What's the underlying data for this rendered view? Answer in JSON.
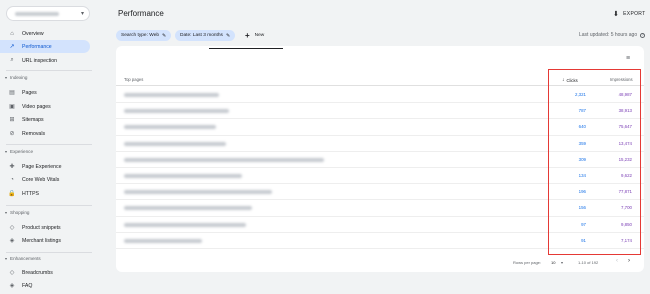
{
  "sidebar": {
    "property_caret": "▾",
    "items": [
      {
        "label": "Overview",
        "icon": "home-icon",
        "glyph": "⌂"
      },
      {
        "label": "Performance",
        "icon": "trend-icon",
        "glyph": "↗"
      },
      {
        "label": "URL inspection",
        "icon": "search-icon",
        "glyph": "⌕"
      }
    ],
    "sections": [
      {
        "title": "Indexing",
        "items": [
          {
            "label": "Pages",
            "glyph": "▤"
          },
          {
            "label": "Video pages",
            "glyph": "▣"
          },
          {
            "label": "Sitemaps",
            "glyph": "⊞"
          },
          {
            "label": "Removals",
            "glyph": "⊘"
          }
        ]
      },
      {
        "title": "Experience",
        "items": [
          {
            "label": "Page Experience",
            "glyph": "✚"
          },
          {
            "label": "Core Web Vitals",
            "glyph": "◔"
          },
          {
            "label": "HTTPS",
            "glyph": "🔒"
          }
        ]
      },
      {
        "title": "Shopping",
        "items": [
          {
            "label": "Product snippets",
            "glyph": "◇"
          },
          {
            "label": "Merchant listings",
            "glyph": "◈"
          }
        ]
      },
      {
        "title": "Enhancements",
        "items": [
          {
            "label": "Breadcrumbs",
            "glyph": "◇"
          },
          {
            "label": "FAQ",
            "glyph": "◈"
          }
        ]
      }
    ]
  },
  "header": {
    "title": "Performance",
    "export_label": "EXPORT",
    "export_glyph": "⬇"
  },
  "filters": {
    "search_type": "Search type: Web",
    "date": "Date: Last 3 months",
    "new_label": "New",
    "new_glyph": "+",
    "edit_glyph": "✎",
    "last_updated": "Last updated: 5 hours ago",
    "help_glyph": "?"
  },
  "table": {
    "filter_glyph": "≡",
    "headers": {
      "top_pages": "Top pages",
      "clicks": "Clicks",
      "impressions": "Impressions",
      "sort_glyph": "↓"
    },
    "rows": [
      {
        "clicks": "2,321",
        "impressions": "48,987",
        "url_width": 95
      },
      {
        "clicks": "787",
        "impressions": "38,913",
        "url_width": 105
      },
      {
        "clicks": "640",
        "impressions": "75,647",
        "url_width": 92
      },
      {
        "clicks": "359",
        "impressions": "13,474",
        "url_width": 102
      },
      {
        "clicks": "309",
        "impressions": "15,232",
        "url_width": 200
      },
      {
        "clicks": "134",
        "impressions": "9,622",
        "url_width": 118
      },
      {
        "clicks": "196",
        "impressions": "77,871",
        "url_width": 148
      },
      {
        "clicks": "156",
        "impressions": "7,700",
        "url_width": 128
      },
      {
        "clicks": "97",
        "impressions": "9,850",
        "url_width": 122
      },
      {
        "clicks": "91",
        "impressions": "7,174",
        "url_width": 78
      }
    ],
    "pagination": {
      "rows_per_page_label": "Rows per page:",
      "rows_per_page_value": "10",
      "range": "1-10 of 192",
      "prev_glyph": "‹",
      "next_glyph": "›",
      "caret": "▾"
    }
  },
  "colors": {
    "accent": "#1a73e8",
    "highlight": "#e53935",
    "impressions": "#7b3fb5",
    "active_nav": "#d3e3fd"
  }
}
